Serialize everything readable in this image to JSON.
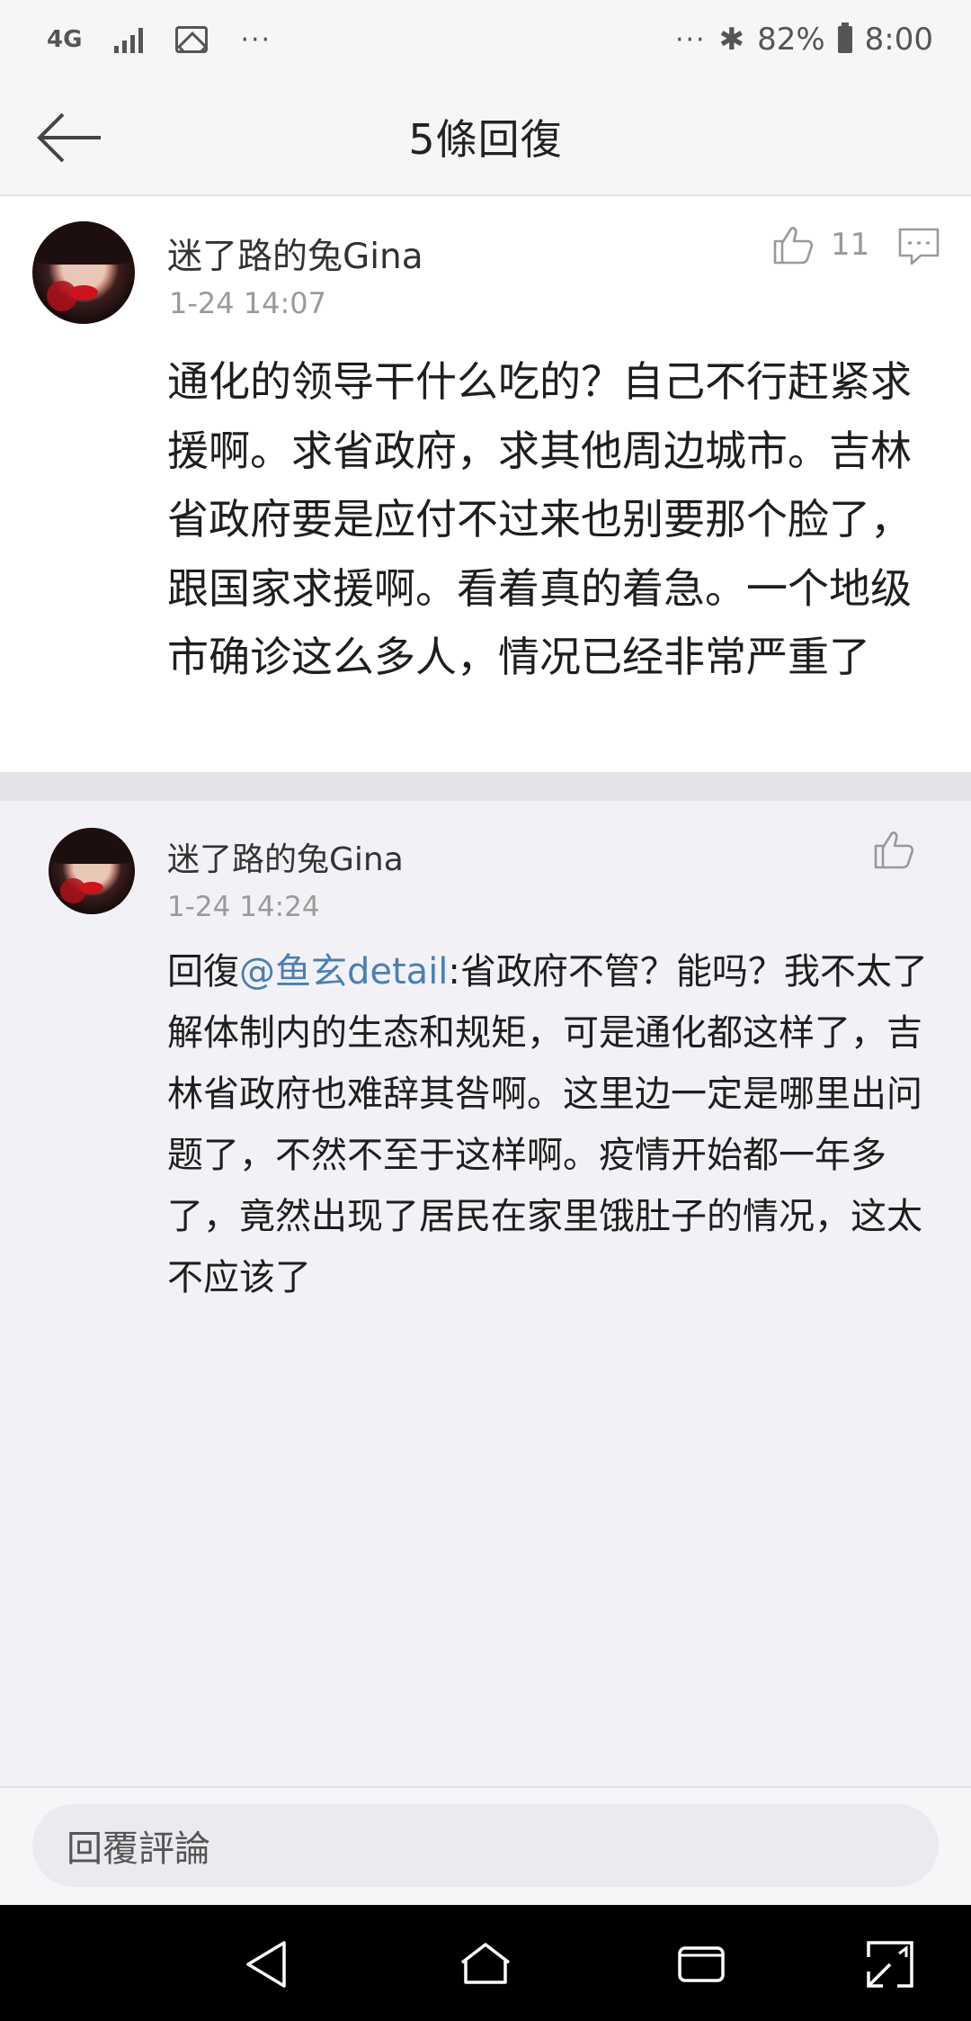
{
  "status_bar": {
    "network": "4G",
    "battery_percent": "82%",
    "time": "8:00",
    "icons": [
      "signal-icon",
      "image-icon",
      "more-dots-icon",
      "bluetooth-icon",
      "battery-icon"
    ]
  },
  "header": {
    "title": "5條回復",
    "back_icon": "arrow-left-icon"
  },
  "main_comment": {
    "username": "迷了路的兔Gina",
    "time": "1-24 14:07",
    "like_count": "11",
    "text": "通化的领导干什么吃的？自己不行赶紧求援啊。求省政府，求其他周边城市。吉林省政府要是应付不过来也别要那个脸了，跟国家求援啊。看着真的着急。一个地级市确诊这么多人，情况已经非常严重了"
  },
  "reply": {
    "username": "迷了路的兔Gina",
    "time": "1-24 14:24",
    "prefix": "回復",
    "mention": "@鱼玄detail",
    "text": ":省政府不管？能吗？我不太了解体制内的生态和规矩，可是通化都这样了，吉林省政府也难辞其咎啊。这里边一定是哪里出问题了，不然不至于这样啊。疫情开始都一年多了，竟然出现了居民在家里饿肚子的情况，这太不应该了"
  },
  "input": {
    "placeholder": "回覆評論"
  },
  "colors": {
    "mention": "#4a7fb5",
    "background": "#f2f2f6",
    "card": "#ffffff"
  }
}
